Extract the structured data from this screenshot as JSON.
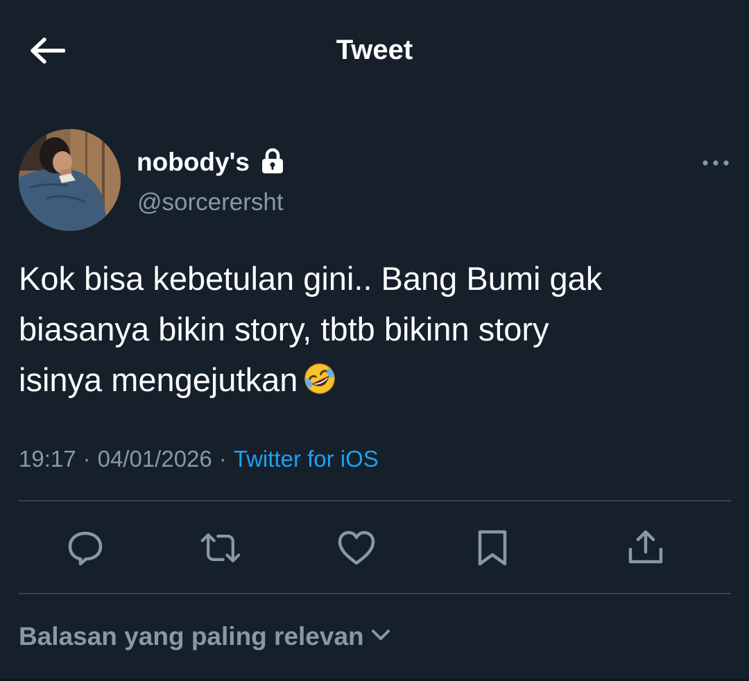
{
  "header": {
    "title": "Tweet",
    "back_icon": "back-arrow-icon"
  },
  "author": {
    "display_name": "nobody's",
    "handle": "@sorcerersht",
    "protected_icon": "lock-icon",
    "more_icon": "more-horizontal-icon"
  },
  "tweet": {
    "text": "Kok bisa kebetulan gini.. Bang Bumi gak\nbiasanya bikin story, tbtb bikinn story\nisinya mengejutkan",
    "emoji": "rolling-on-the-floor-laughing-emoji",
    "time": "19:17",
    "date": "04/01/2026",
    "separator": "·",
    "source": "Twitter for iOS"
  },
  "actions": {
    "reply_icon": "reply-icon",
    "retweet_icon": "retweet-icon",
    "like_icon": "heart-icon",
    "bookmark_icon": "bookmark-icon",
    "share_icon": "share-icon"
  },
  "replies": {
    "sort_label": "Balasan yang paling relevan",
    "chevron_icon": "chevron-down-icon"
  },
  "colors": {
    "background": "#15202b",
    "primary_text": "#ffffff",
    "secondary_text": "#8899a6",
    "accent": "#1da1f2",
    "divider": "#38444d",
    "icon": "#8899a6"
  }
}
